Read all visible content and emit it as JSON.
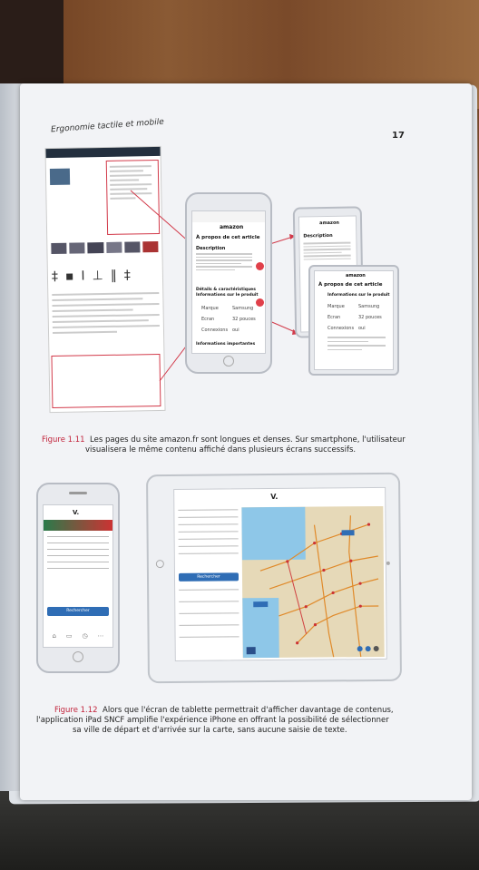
{
  "page": {
    "running_header": "Ergonomie tactile et mobile",
    "page_number": "17"
  },
  "figure_1_11": {
    "label": "Figure 1.11",
    "caption_line1": "Les pages du site amazon.fr sont longues et denses. Sur smartphone, l'utilisateur",
    "caption_line2": "visualisera le même contenu affiché dans plusieurs écrans successifs.",
    "phone1": {
      "logo": "amazon",
      "section_title": "À propos de cet article",
      "description_title": "Description",
      "details_title": "Détails & caractéristiques",
      "info_title": "Informations sur le produit",
      "row1_label": "Marque",
      "row1_value": "Samsung",
      "row2_label": "Écran",
      "row2_value": "32 pouces",
      "row3_label": "Connexions",
      "row3_value": "oui",
      "footer_title": "Informations importantes",
      "badge1": "1",
      "badge2": "2"
    },
    "phone2": {
      "logo": "amazon",
      "description_title": "Description"
    },
    "phone3": {
      "logo": "amazon",
      "section_title": "À propos de cet article",
      "info_title": "Informations sur le produit",
      "row1_label": "Marque",
      "row1_value": "Samsung",
      "row2_label": "Écran",
      "row2_value": "32 pouces",
      "row3_label": "Connexions",
      "row3_value": "oui"
    }
  },
  "figure_1_12": {
    "label": "Figure 1.12",
    "caption_line1": "Alors que l'écran de tablette permettrait d'afficher davantage de contenus,",
    "caption_line2": "l'application iPad SNCF amplifie l'expérience iPhone en offrant la possibilité de sélectionner",
    "caption_line3": "sa ville de départ et d'arrivée sur la carte, sans aucune saisie de texte.",
    "phone": {
      "logo": "V.",
      "search_button": "Rechercher"
    },
    "tablet": {
      "logo": "V.",
      "search_button": "Rechercher"
    }
  },
  "colors": {
    "caption_label": "#c2233b",
    "arrow": "#d23a4a",
    "sncf_blue": "#2f6db5",
    "map_sea": "#8ec7e8",
    "map_land": "#e6d9b8",
    "road": "#e08a2a"
  }
}
